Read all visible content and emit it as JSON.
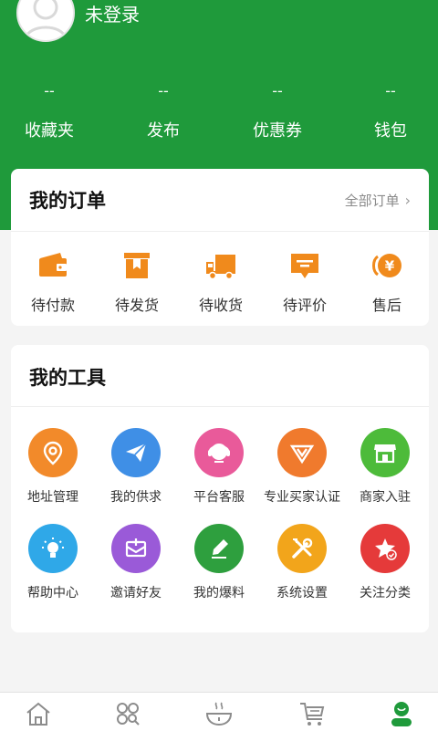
{
  "header": {
    "login_text": "未登录",
    "stats": [
      {
        "value": "--",
        "label": "收藏夹"
      },
      {
        "value": "--",
        "label": "发布"
      },
      {
        "value": "--",
        "label": "优惠券"
      },
      {
        "value": "--",
        "label": "钱包"
      }
    ]
  },
  "orders": {
    "title": "我的订单",
    "all_label": "全部订单",
    "items": [
      {
        "label": "待付款",
        "icon": "wallet-icon"
      },
      {
        "label": "待发货",
        "icon": "package-icon"
      },
      {
        "label": "待收货",
        "icon": "truck-icon"
      },
      {
        "label": "待评价",
        "icon": "comment-icon"
      },
      {
        "label": "售后",
        "icon": "after-sale-icon"
      }
    ]
  },
  "tools": {
    "title": "我的工具",
    "items": [
      {
        "label": "地址管理",
        "icon": "location-icon",
        "color": "#f28a2a"
      },
      {
        "label": "我的供求",
        "icon": "paper-plane-icon",
        "color": "#3f8fe6"
      },
      {
        "label": "平台客服",
        "icon": "customer-service-icon",
        "color": "#e95a9a"
      },
      {
        "label": "专业买家认证",
        "icon": "verified-v-icon",
        "color": "#f07a2d"
      },
      {
        "label": "商家入驻",
        "icon": "store-icon",
        "color": "#4dbb3a"
      },
      {
        "label": "帮助中心",
        "icon": "lightbulb-icon",
        "color": "#2fa8e8"
      },
      {
        "label": "邀请好友",
        "icon": "invite-mail-icon",
        "color": "#9a5ad8"
      },
      {
        "label": "我的爆料",
        "icon": "pencil-icon",
        "color": "#2e9f3e"
      },
      {
        "label": "系统设置",
        "icon": "tools-icon",
        "color": "#f2a51b"
      },
      {
        "label": "关注分类",
        "icon": "star-badge-icon",
        "color": "#e53a3a"
      }
    ]
  },
  "tabbar": {
    "items": [
      {
        "icon": "home-icon"
      },
      {
        "icon": "categories-icon"
      },
      {
        "icon": "bowl-icon"
      },
      {
        "icon": "cart-icon"
      },
      {
        "icon": "profile-icon",
        "active": true
      }
    ],
    "active_color": "#1f9a3b",
    "inactive_color": "#8c8c8c"
  },
  "theme": {
    "brand_green": "#1f9a3b",
    "order_orange": "#f08a1c"
  }
}
